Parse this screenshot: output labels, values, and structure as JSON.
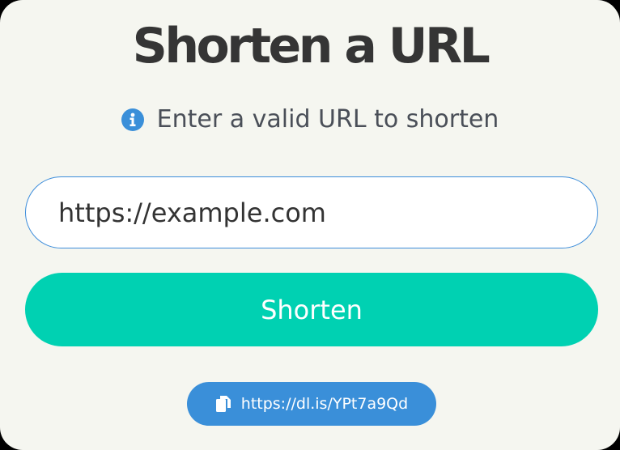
{
  "header": {
    "title": "Shorten a URL"
  },
  "hint": {
    "icon": "info-icon",
    "text": "Enter a valid URL to shorten"
  },
  "form": {
    "url_value": "https://example.com",
    "submit_label": "Shorten"
  },
  "result": {
    "icon": "copy-icon",
    "short_url": "https://dl.is/YPt7a9Qd"
  },
  "colors": {
    "background": "#f5f6f0",
    "accent": "#00d1b2",
    "info": "#3a8fd9",
    "title": "#353535"
  }
}
